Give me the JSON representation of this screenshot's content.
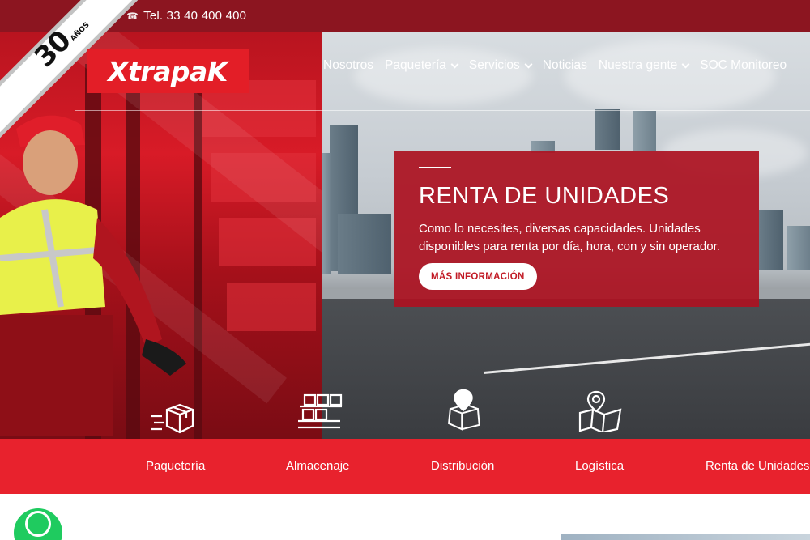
{
  "topbar": {
    "phone_icon": "phone-icon",
    "phone": "Tel. 33 40 400 400"
  },
  "ribbon": {
    "number": "30",
    "sub": "AÑOS"
  },
  "logo": {
    "text": "XtrapaK"
  },
  "nav": {
    "items": [
      {
        "label": "Nosotros",
        "dropdown": false
      },
      {
        "label": "Paquetería",
        "dropdown": true
      },
      {
        "label": "Servicios",
        "dropdown": true
      },
      {
        "label": "Noticias",
        "dropdown": false
      },
      {
        "label": "Nuestra gente",
        "dropdown": true
      },
      {
        "label": "SOC Monitoreo",
        "dropdown": false
      }
    ]
  },
  "hero": {
    "title": "RENTA DE UNIDADES",
    "description": "Como lo necesites, diversas capacidades. Unidades disponibles para renta por día, hora, con y sin operador.",
    "button": "MÁS INFORMACIÓN"
  },
  "services": {
    "icons": [
      "package-delivery-icon",
      "warehouse-boxes-icon",
      "distribution-location-icon",
      "logistics-map-icon"
    ],
    "items": [
      "Paquetería",
      "Almacenaje",
      "Distribución",
      "Logística",
      "Renta de Unidades"
    ]
  },
  "colors": {
    "topbar": "#8c1520",
    "brand_red": "#e31e27",
    "band_red": "#e8222d",
    "hero_card": "#ac1221",
    "whatsapp": "#1fcb5f"
  }
}
